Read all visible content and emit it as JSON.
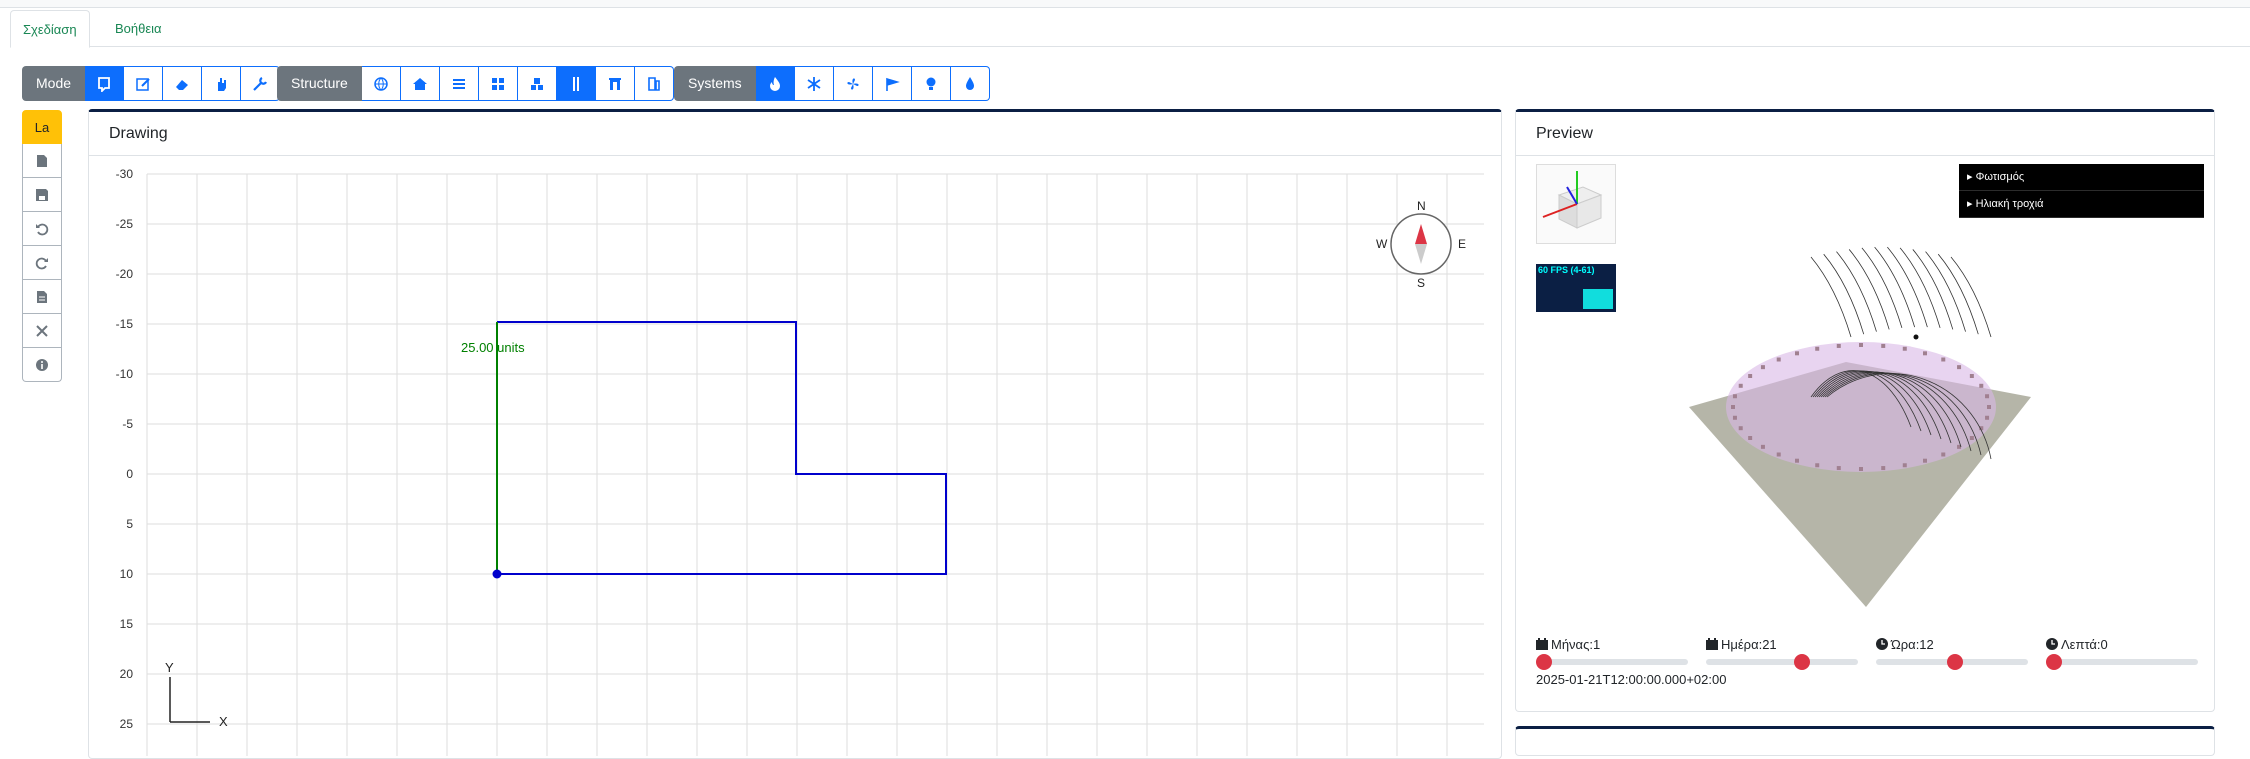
{
  "tabs": [
    {
      "label": "Σχεδίαση",
      "active": true
    },
    {
      "label": "Βοήθεια",
      "active": false
    }
  ],
  "toolbar": {
    "mode_label": "Mode",
    "structure_label": "Structure",
    "systems_label": "Systems",
    "mode_buttons": [
      "select-icon",
      "edit-icon",
      "eraser-icon",
      "hand-icon",
      "wrench-icon"
    ],
    "structure_buttons": [
      "globe-icon",
      "house-icon",
      "list-icon",
      "grid-icon",
      "blocks-icon",
      "wall-icon",
      "door-icon",
      "window-icon"
    ],
    "systems_buttons": [
      "fire-icon",
      "snowflake-icon",
      "fan-icon",
      "solar-icon",
      "bulb-icon",
      "droplet-icon"
    ]
  },
  "sidebar": {
    "first_label": "La",
    "buttons": [
      "file-icon",
      "save-icon",
      "undo-icon",
      "redo-icon",
      "document-icon",
      "tools-icon",
      "info-icon"
    ]
  },
  "drawing": {
    "title": "Drawing",
    "y_ticks": [
      "-30",
      "-25",
      "-20",
      "-15",
      "-10",
      "-5",
      "0",
      "5",
      "10",
      "15",
      "20",
      "25"
    ],
    "dimension_label": "25.00 units",
    "compass": {
      "n": "N",
      "s": "S",
      "e": "E",
      "w": "W"
    },
    "axis_x": "X",
    "axis_y": "Y",
    "colors": {
      "wall": "#0000cc",
      "selected_wall": "#008000",
      "grid": "#dddddd"
    }
  },
  "preview": {
    "title": "Preview",
    "fps": "60 FPS (4-61)",
    "gui_items": [
      "Φωτισμός",
      "Ηλιακή τροχιά"
    ],
    "sliders": [
      {
        "label": "Μήνας:1",
        "icon": "calendar-icon",
        "value": 0.0
      },
      {
        "label": "Ημέρα:21",
        "icon": "calendar-icon",
        "value": 0.65
      },
      {
        "label": "Ώρα:12",
        "icon": "clock-icon",
        "value": 0.52
      },
      {
        "label": "Λεπτά:0",
        "icon": "clock-icon",
        "value": 0.0
      }
    ],
    "datetime": "2025-01-21T12:00:00.000+02:00"
  }
}
